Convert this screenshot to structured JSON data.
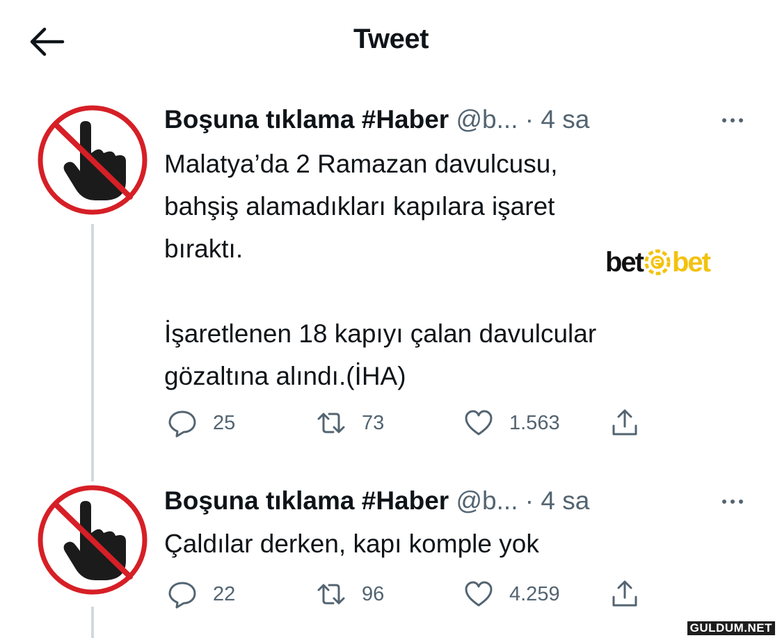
{
  "header": {
    "title": "Tweet"
  },
  "tweets": [
    {
      "author_name": "Boşuna tıklama #Haber",
      "handle": "@b...",
      "separator": "·",
      "time": "4 sa",
      "text": "Malatya’da 2 Ramazan davulcusu,\nbahşiş alamadıkları kapılara işaret\nbıraktı.\n\nİşaretlenen 18 kapıyı çalan davulcular\ngözaltına alındı.(İHA)",
      "replies": "25",
      "retweets": "73",
      "likes": "1.563"
    },
    {
      "author_name": "Boşuna tıklama #Haber",
      "handle": "@b...",
      "separator": "·",
      "time": "4 sa",
      "text": "Çaldılar derken, kapı komple yok",
      "replies": "22",
      "retweets": "96",
      "likes": "4.259"
    }
  ],
  "brand_overlay": {
    "part1": "bet",
    "part2": "bet"
  },
  "watermark": "GULDUM.NET",
  "colors": {
    "text": "#0f1419",
    "secondary": "#536471",
    "ban_red": "#d61f26",
    "thread_line": "#cfd9de",
    "brand_yellow": "#f4c20d"
  },
  "icons": [
    "back-arrow-icon",
    "more-options-icon",
    "reply-icon",
    "retweet-icon",
    "like-icon",
    "share-icon",
    "no-touch-avatar-icon"
  ]
}
